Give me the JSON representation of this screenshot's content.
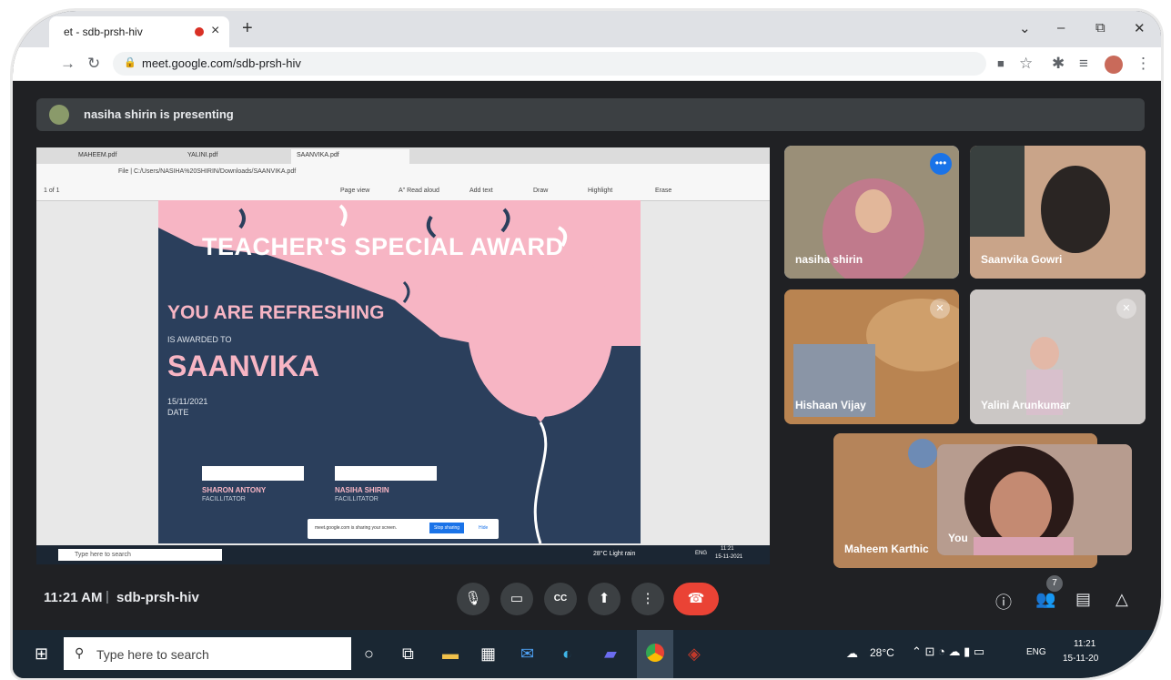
{
  "browser": {
    "tab_title": "et - sdb-prsh-hiv",
    "tab_close": "×",
    "new_tab": "+",
    "window_minimize": "–",
    "window_restore": "⧉",
    "window_close": "✕",
    "window_chevron": "⌄",
    "url": "meet.google.com/sdb-prsh-hiv"
  },
  "meet": {
    "presenter_banner": "nasiha shirin is presenting",
    "time": "11:21 AM",
    "separator": "|",
    "meeting_code": "sdb-prsh-hiv",
    "people_count": "7"
  },
  "shared_screen": {
    "tabs": [
      "MAHEEM.pdf",
      "YALINI.pdf",
      "SAANVIKA.pdf"
    ],
    "address": "File  |  C:/Users/NASIHA%20SHIRIN/Downloads/SAANVIKA.pdf",
    "page_indicator": "1   of 1",
    "toolbar": [
      "Page view",
      "A\" Read aloud",
      "Add text",
      "Draw",
      "Highlight",
      "Erase"
    ],
    "share_notice": "meet.google.com is sharing your screen.",
    "stop_sharing": "Stop sharing",
    "hide": "Hide",
    "mini_search": "Type here to search",
    "mini_weather": "28°C  Light rain",
    "mini_lang": "ENG",
    "mini_time": "11:21",
    "mini_date": "15-11-2021",
    "certificate": {
      "title": "TEACHER'S SPECIAL AWARD",
      "headline": "YOU ARE REFRESHING",
      "awarded_to": "IS AWARDED TO",
      "name": "SAANVIKA",
      "date_value": "15/11/2021",
      "date_label": "DATE",
      "signer1_name": "SHARON ANTONY",
      "signer1_role": "FACILLITATOR",
      "signer2_name": "NASIHA SHIRIN",
      "signer2_role": "FACILLITATOR"
    }
  },
  "participants": [
    {
      "name": "nasiha shirin"
    },
    {
      "name": "Saanvika Gowri"
    },
    {
      "name": "Hishaan Vijay"
    },
    {
      "name": "Yalini Arunkumar"
    },
    {
      "name": "Maheem Karthic"
    },
    {
      "name": "You"
    }
  ],
  "taskbar": {
    "search_placeholder": "Type here to search",
    "weather": "28°C",
    "lang": "ENG",
    "time": "11:21",
    "date": "15-11-20"
  },
  "colors": {
    "meet_bg": "#202124",
    "end_call": "#ea4335",
    "cert_pink": "#f7b5c4",
    "cert_navy": "#2b3f5c",
    "active_speaker": "#8ab4f8"
  }
}
